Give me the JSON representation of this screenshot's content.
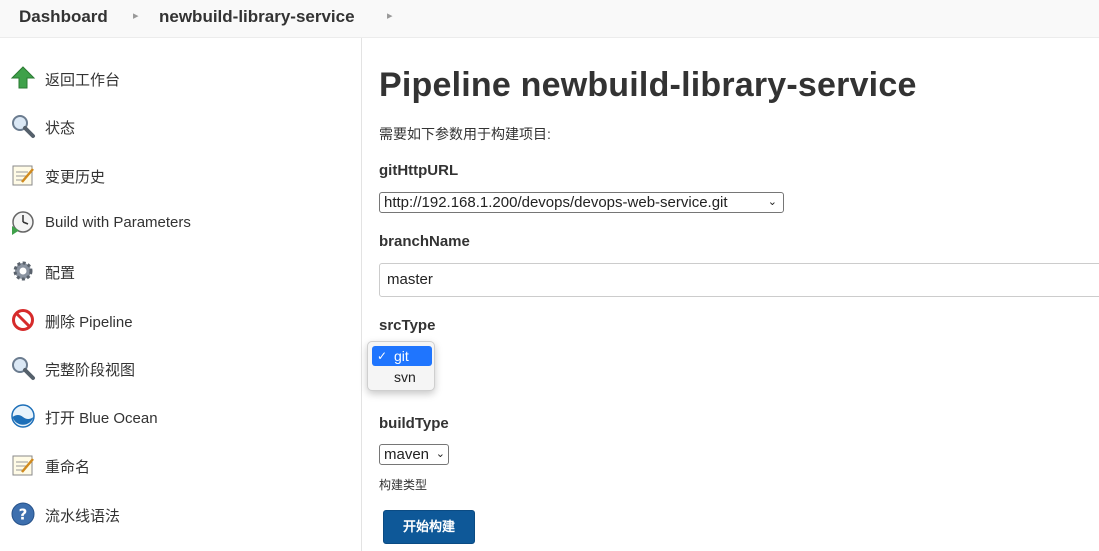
{
  "breadcrumb": {
    "items": [
      "Dashboard",
      "newbuild-library-service"
    ]
  },
  "sidebar": {
    "items": [
      {
        "label": "返回工作台",
        "icon": "up-arrow-icon"
      },
      {
        "label": "状态",
        "icon": "magnifier-icon"
      },
      {
        "label": "变更历史",
        "icon": "notepad-icon"
      },
      {
        "label": "Build with Parameters",
        "icon": "clock-play-icon"
      },
      {
        "label": "配置",
        "icon": "gear-icon"
      },
      {
        "label": "删除 Pipeline",
        "icon": "no-entry-icon"
      },
      {
        "label": "完整阶段视图",
        "icon": "magnifier-icon"
      },
      {
        "label": "打开 Blue Ocean",
        "icon": "blue-ocean-icon"
      },
      {
        "label": "重命名",
        "icon": "notepad-icon"
      },
      {
        "label": "流水线语法",
        "icon": "help-icon"
      }
    ]
  },
  "main": {
    "title": "Pipeline newbuild-library-service",
    "intro": "需要如下参数用于构建项目:",
    "params": {
      "gitHttpURL": {
        "label": "gitHttpURL",
        "value": "http://192.168.1.200/devops/devops-web-service.git"
      },
      "branchName": {
        "label": "branchName",
        "value": "master"
      },
      "srcType": {
        "label": "srcType",
        "options": [
          "git",
          "svn"
        ],
        "selected": "git"
      },
      "buildType": {
        "label": "buildType",
        "value": "maven",
        "description": "构建类型"
      }
    },
    "build_button": "开始构建"
  },
  "colors": {
    "accent": "#1f75fe",
    "button": "#0e5898"
  }
}
